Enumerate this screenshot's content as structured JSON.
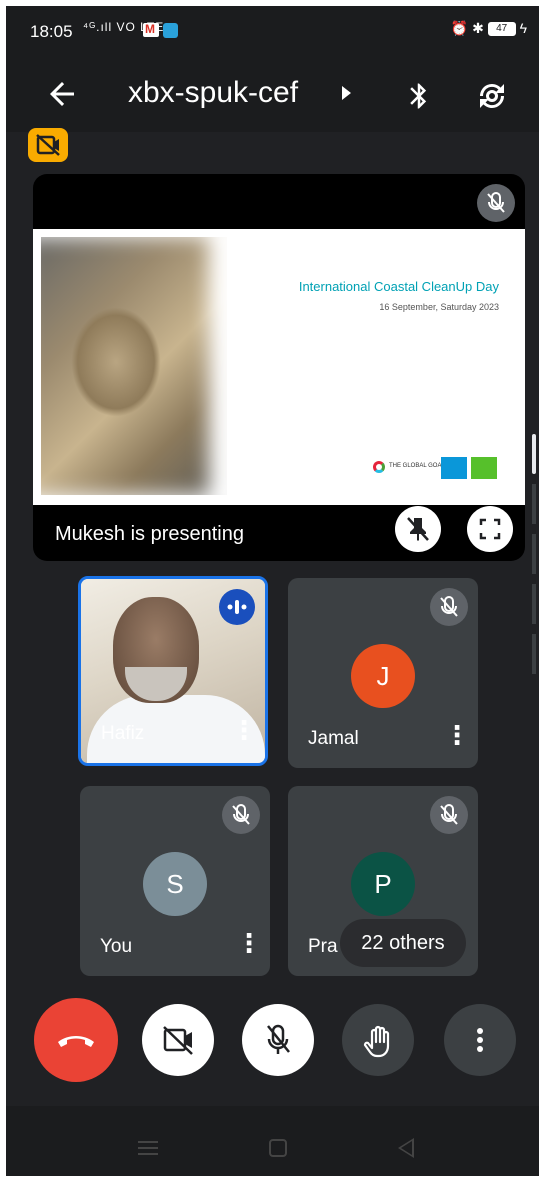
{
  "status_bar": {
    "time": "18:05",
    "network": "⁴ᴳ.ıll VO LTE",
    "battery": "47",
    "icons": [
      "signal-icon",
      "gmail-icon",
      "telegram-icon",
      "alarm-icon",
      "bluetooth-icon",
      "battery-icon"
    ]
  },
  "app_bar": {
    "meeting_code": "xbx-spuk-cef"
  },
  "presentation": {
    "slide_title": "International Coastal CleanUp Day",
    "slide_date": "16 September, Saturday 2023",
    "slide_footer": "THE GLOBAL GOALS",
    "presenting_label": "Mukesh is presenting"
  },
  "participants": [
    {
      "name": "Hafiz",
      "initial": "",
      "video": true,
      "muted": false,
      "speaking": true,
      "color": ""
    },
    {
      "name": "Jamal",
      "initial": "J",
      "video": false,
      "muted": true,
      "speaking": false,
      "color": "#e8501f"
    },
    {
      "name": "You",
      "initial": "S",
      "video": false,
      "muted": true,
      "speaking": false,
      "color": "#7b8e98"
    },
    {
      "name": "Pra",
      "initial": "P",
      "video": false,
      "muted": true,
      "speaking": false,
      "color": "#0b5345"
    }
  ],
  "others_chip": "22 others",
  "controls": {
    "end_call": "end-call-icon",
    "camera": "camera-off-icon",
    "mic": "mic-off-icon",
    "hand": "raise-hand-icon",
    "more": "more-vert-icon"
  },
  "colors": {
    "background": "#202124",
    "end_call": "#ea4335",
    "active_border": "#1a73e8",
    "hidden_badge": "#f9ab00"
  }
}
